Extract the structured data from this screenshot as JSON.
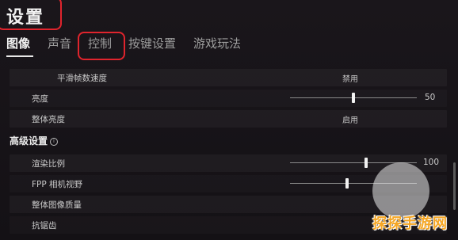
{
  "header": {
    "title": "设置"
  },
  "tabs": [
    {
      "label": "图像",
      "active": true
    },
    {
      "label": "声音"
    },
    {
      "label": "控制",
      "highlighted": true
    },
    {
      "label": "按键设置"
    },
    {
      "label": "游戏玩法"
    }
  ],
  "rows": {
    "smooth_fps": {
      "label": "平滑帧数速度",
      "value": "禁用"
    },
    "brightness": {
      "label": "亮度",
      "value": "50",
      "level": 0.5
    },
    "overall_brightness": {
      "label": "整体亮度",
      "value": "启用"
    }
  },
  "advanced": {
    "heading": "高级设置",
    "info_glyph": "i",
    "render_scale": {
      "label": "渲染比例",
      "value": "100",
      "level": 0.6
    },
    "fpp_fov": {
      "label": "FPP 相机视野",
      "level": 0.45
    },
    "image_quality": {
      "label": "整体图像质量"
    },
    "anti_aliasing": {
      "label": "抗锯齿"
    }
  },
  "watermark": {
    "text": "探探手游网"
  },
  "colors": {
    "highlight": "#e0242d",
    "background": "#151216"
  }
}
